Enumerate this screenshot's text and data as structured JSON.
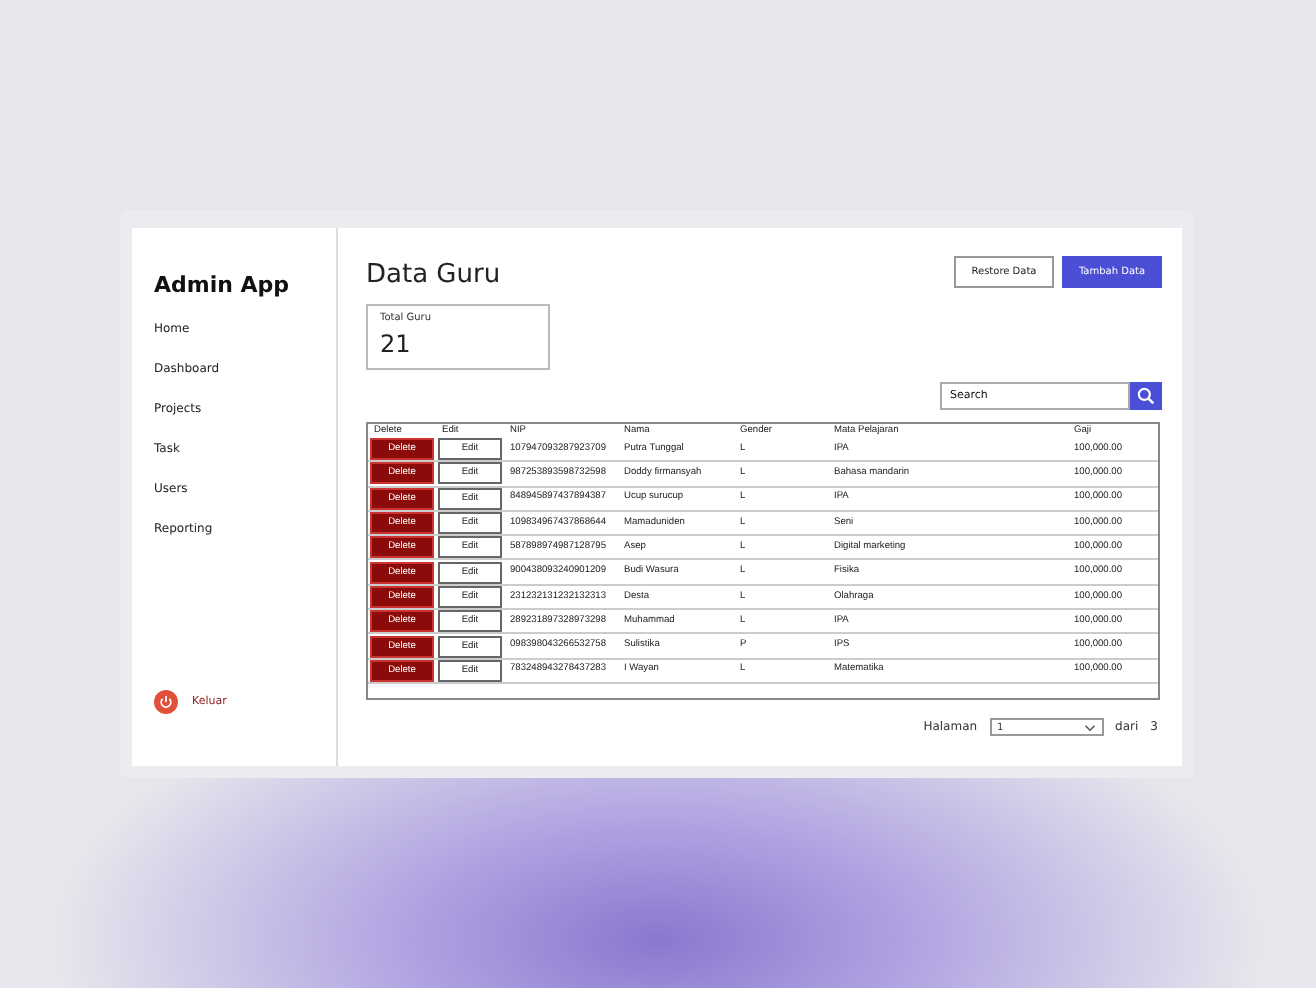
{
  "sidebar": {
    "title": "Admin App",
    "items": [
      {
        "label": "Home"
      },
      {
        "label": "Dashboard"
      },
      {
        "label": "Projects"
      },
      {
        "label": "Task"
      },
      {
        "label": "Users"
      },
      {
        "label": "Reporting"
      }
    ],
    "logout": "Keluar"
  },
  "page": {
    "title": "Data Guru",
    "buttons": [
      {
        "label": "Restore Data",
        "kind": "outline"
      },
      {
        "label": "Tambah Data",
        "kind": "primary"
      }
    ]
  },
  "stat": {
    "label": "Total Guru",
    "value": "21"
  },
  "search": {
    "placeholder": "Search"
  },
  "table": {
    "columns": [
      "Delete",
      "Edit",
      "NIP",
      "Nama",
      "Gender",
      "Mata Pelajaran",
      "Gaji"
    ],
    "rows": [
      {
        "delete": "Delete",
        "edit": "Edit",
        "nip": "107947093287923709",
        "nama": "Putra Tunggal",
        "gender": "L",
        "mapel": "IPA",
        "gaji": "100,000.00"
      },
      {
        "delete": "Delete",
        "edit": "Edit",
        "nip": "987253893598732598",
        "nama": "Doddy firmansyah",
        "gender": "L",
        "mapel": "Bahasa mandarin",
        "gaji": "100,000.00"
      },
      {
        "delete": "Delete",
        "edit": "Edit",
        "nip": "848945897437894387",
        "nama": "Ucup surucup",
        "gender": "L",
        "mapel": "IPA",
        "gaji": "100,000.00"
      },
      {
        "delete": "Delete",
        "edit": "Edit",
        "nip": "109834967437868644",
        "nama": "Mamaduniden",
        "gender": "L",
        "mapel": "Seni",
        "gaji": "100,000.00"
      },
      {
        "delete": "Delete",
        "edit": "Edit",
        "nip": "587898974987128795",
        "nama": "Asep",
        "gender": "L",
        "mapel": "Digital marketing",
        "gaji": "100,000.00"
      },
      {
        "delete": "Delete",
        "edit": "Edit",
        "nip": "900438093240901209",
        "nama": "Budi Wasura",
        "gender": "L",
        "mapel": "Fisika",
        "gaji": "100,000.00"
      },
      {
        "delete": "Delete",
        "edit": "Edit",
        "nip": "231232131232132313",
        "nama": "Desta",
        "gender": "L",
        "mapel": "Olahraga",
        "gaji": "100,000.00"
      },
      {
        "delete": "Delete",
        "edit": "Edit",
        "nip": "289231897328973298",
        "nama": "Muhammad",
        "gender": "L",
        "mapel": "IPA",
        "gaji": "100,000.00"
      },
      {
        "delete": "Delete",
        "edit": "Edit",
        "nip": "098398043266532758",
        "nama": "Sulistika",
        "gender": "P",
        "mapel": "IPS",
        "gaji": "100,000.00"
      },
      {
        "delete": "Delete",
        "edit": "Edit",
        "nip": "783248943278437283",
        "nama": "I Wayan",
        "gender": "L",
        "mapel": "Matematika",
        "gaji": "100,000.00"
      }
    ]
  },
  "pagination": {
    "label": "Halaman",
    "value": "1",
    "of": "dari",
    "total": "3"
  }
}
